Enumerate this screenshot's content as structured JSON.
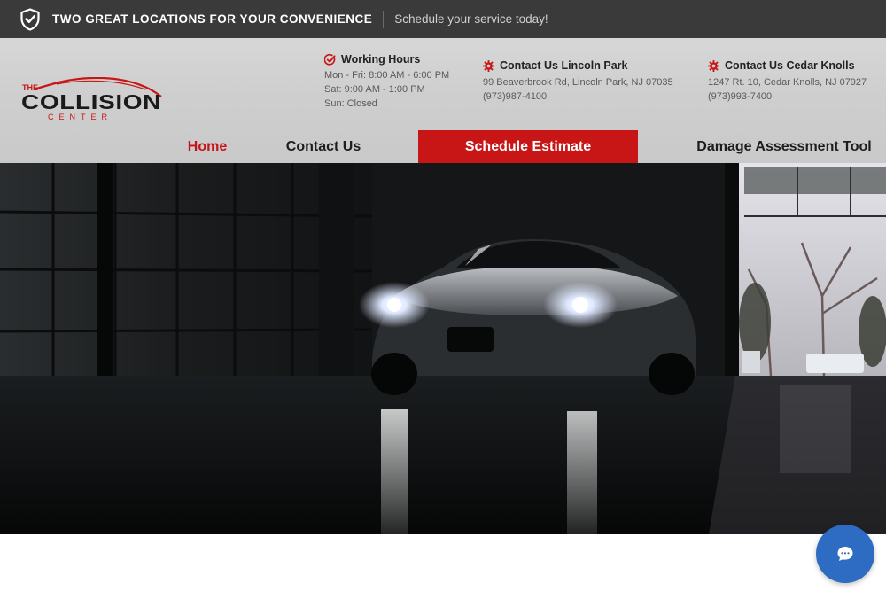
{
  "topbar": {
    "headline": "TWO GREAT LOCATIONS FOR YOUR CONVENIENCE",
    "tagline": "Schedule your service today!"
  },
  "logo": {
    "line1": "THE",
    "line2": "COLLISION",
    "line3": "CENTER"
  },
  "hours": {
    "title": "Working Hours",
    "lines": [
      "Mon - Fri: 8:00 AM - 6:00 PM",
      "Sat: 9:00 AM - 1:00 PM",
      "Sun: Closed"
    ]
  },
  "locations": [
    {
      "title": "Contact Us Lincoln Park",
      "address": "99 Beaverbrook Rd, Lincoln Park, NJ 07035",
      "phone": "(973)987-4100"
    },
    {
      "title": "Contact Us Cedar Knolls",
      "address": "1247 Rt. 10, Cedar Knolls, NJ 07927",
      "phone": "(973)993-7400"
    }
  ],
  "nav": {
    "home": "Home",
    "contact": "Contact Us",
    "schedule": "Schedule Estimate",
    "damage": "Damage Assessment Tool"
  },
  "colors": {
    "brand_red": "#c81515",
    "topbar": "#3a3a3a",
    "chat_blue": "#2e6bc2"
  },
  "icons": {
    "topbar": "shield-check-icon",
    "hours": "check-circle-icon",
    "location": "gear-icon",
    "chat": "chat-bubble-icon"
  }
}
